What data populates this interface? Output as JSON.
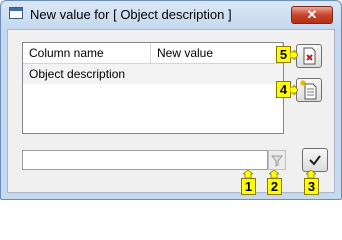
{
  "window": {
    "title": "New value for [ Object description ]",
    "close_label": "✕"
  },
  "grid": {
    "columns": [
      "Column name",
      "New value"
    ],
    "rows": [
      {
        "column_name": "Object description",
        "new_value": ""
      }
    ]
  },
  "value_field": {
    "value": "",
    "placeholder": ""
  },
  "callouts": {
    "input_field": "1",
    "filter_button": "2",
    "confirm_button": "3",
    "add_button": "4",
    "clear_button": "5"
  },
  "icons": {
    "app": "window-app-icon",
    "close": "close-icon",
    "filter": "funnel-icon",
    "confirm": "checkmark-icon",
    "add": "new-document-icon",
    "clear": "delete-document-icon"
  },
  "colors": {
    "callout_fill": "#ffff00",
    "title_bar": "#c4d7ee",
    "close_button": "#c8452a"
  }
}
